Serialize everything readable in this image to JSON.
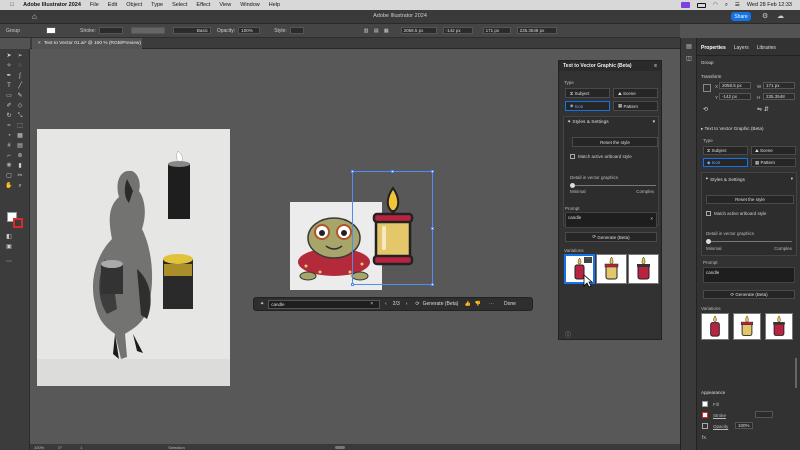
{
  "menubar": {
    "app": "Adobe Illustrator 2024",
    "items": [
      "File",
      "Edit",
      "Object",
      "Type",
      "Select",
      "Effect",
      "View",
      "Window",
      "Help"
    ],
    "clock": "Wed 28 Feb 12:33"
  },
  "appbar": {
    "title": "Adobe Illustrator 2024",
    "share": "Share"
  },
  "control": {
    "selection": "Group",
    "stroke_label": "Stroke:",
    "brush": "Basic",
    "opacity_label": "Opacity:",
    "opacity": "100%",
    "style_label": "Style:",
    "x": "2058.5 px",
    "y": "-142 px",
    "w": "171 px",
    "h": "235.3548 px"
  },
  "doc_tab": "Text to Vector 01.ai* @ 100 % (RGB/Preview)",
  "float_panel": {
    "title": "Text to Vector Graphic (Beta)",
    "type_label": "Type",
    "types": [
      "Subject",
      "Scene",
      "Icon",
      "Pattern"
    ],
    "styles_label": "Styles & Settings",
    "reset": "Reset the style",
    "match": "Match active artboard style",
    "detail": "Detail in vector graphics",
    "minimal": "Minimal",
    "complex": "Complex",
    "prompt_label": "Prompt",
    "prompt": "candle",
    "generate": "Generate (Beta)",
    "variations": "Variations"
  },
  "contextbar": {
    "prompt": "candle",
    "page": "2/3",
    "generate": "Generate (Beta)",
    "done": "Done"
  },
  "right_panel": {
    "tabs": [
      "Properties",
      "Layers",
      "Libraries"
    ],
    "group": "Group",
    "transform": "Transform",
    "x": "2058.5 px",
    "y": "-142 px",
    "w": "171 px",
    "h": "235.3548",
    "ttv_title": "Text to Vector Graphic (Beta)",
    "type_label": "Type",
    "types": [
      "Subject",
      "Scene",
      "Icon",
      "Pattern"
    ],
    "styles_label": "Styles & Settings",
    "reset": "Reset the style",
    "match": "Match active artboard style",
    "detail": "Detail in vector graphics",
    "minimal": "Minimal",
    "complex": "Complex",
    "prompt_label": "Prompt",
    "prompt": "candle",
    "generate": "Generate (Beta)",
    "variations": "Variations",
    "appearance": "Appearance",
    "fill": "Fill",
    "stroke": "Stroke",
    "opacity_label": "Opacity",
    "opacity": "100%"
  },
  "status": {
    "zoom": "100%",
    "angle": "0°",
    "page": "1",
    "tool": "Selection"
  },
  "colors": {
    "accent": "#1473e6",
    "candle_red": "#b8243f",
    "candle_yellow": "#e3c76a"
  }
}
